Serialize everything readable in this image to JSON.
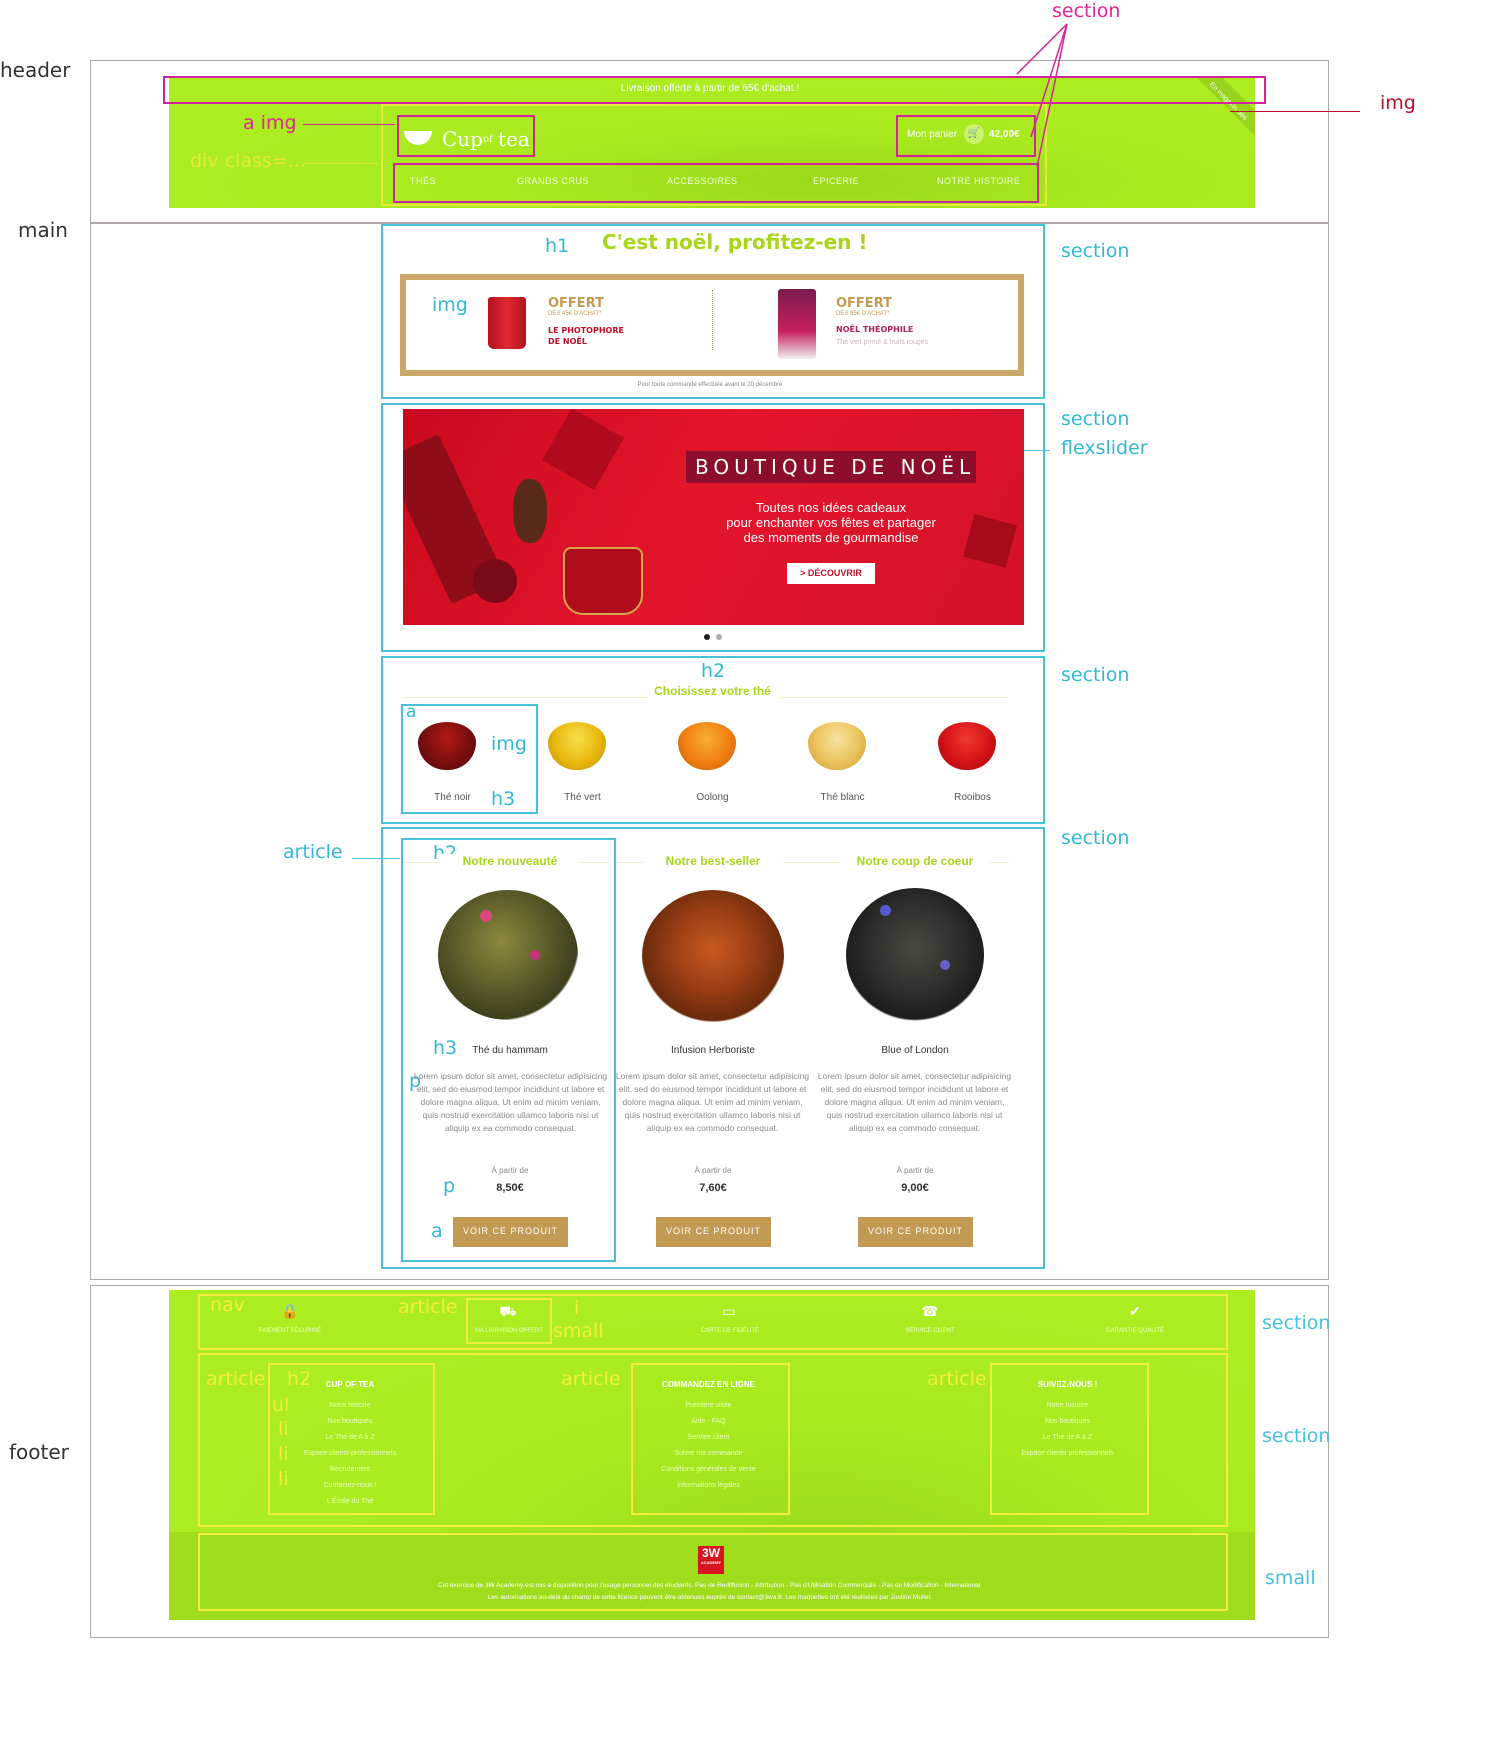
{
  "regions": {
    "header": "header",
    "main": "main",
    "footer": "footer"
  },
  "annotations": {
    "section_top": "section",
    "img_corner": "img",
    "a_img": "a img",
    "div_class": "div class=...",
    "h1": "h1",
    "img_offer": "img",
    "section_h1": "section",
    "section_slider": "section",
    "flexslider": "flexslider",
    "h2_choose": "h2",
    "a_cup": "a",
    "img_cup": "img",
    "h3_cup": "h3",
    "section_choose": "section",
    "article": "article",
    "h2_prod": "h2",
    "section_prod": "section",
    "h3_prod": "h3",
    "p_desc": "p",
    "p_price": "p",
    "a_btn": "a",
    "nav": "nav",
    "article_nav": "article",
    "i": "i",
    "small_nav": "small",
    "section_nav": "section",
    "article_1": "article",
    "h2_footer": "h2",
    "ul": "ul",
    "li_1": "li",
    "li_2": "li",
    "li_3": "li",
    "li_4": "li",
    "article_2": "article",
    "article_3": "article",
    "section_footer": "section",
    "small_footer": "small"
  },
  "header": {
    "topbar": "Livraison offerte à partir de 65€ d'achat !",
    "logo": {
      "cup": "Cup",
      "of": "of",
      "tea": "tea"
    },
    "cart_label": "Mon panier",
    "cart_total": "42,00€",
    "ribbon": "En magasin dès",
    "nav": [
      "THÉS",
      "GRANDS CRUS",
      "ACCESSOIRES",
      "EPICERIE",
      "NOTRE HISTOIRE"
    ]
  },
  "promo": {
    "title": "C'est noël, profitez-en !",
    "offer1": {
      "title": "OFFERT",
      "sub": "DÈS 45€ D'ACHAT*",
      "name1": "LE PHOTOPHORE",
      "name2": "DE NOËL"
    },
    "offer2": {
      "title": "OFFERT",
      "sub": "DÈS 85€ D'ACHAT*",
      "name": "NOËL THÉOPHILE",
      "desc": "Thé vert primé & fruits rouges"
    },
    "footnote": "Pour toute commande effectuée avant le 20 décembre"
  },
  "slider": {
    "title": "BOUTIQUE DE NOËL",
    "line1": "Toutes nos idées cadeaux",
    "line2": "pour enchanter vos fêtes et partager",
    "line3": "des moments de gourmandise",
    "button": "> DÉCOUVRIR"
  },
  "choose": {
    "title": "Choisissez votre thé",
    "teas": [
      {
        "label": "Thé noir",
        "color": "#7a0e10"
      },
      {
        "label": "Thé vert",
        "color": "#e8b80e"
      },
      {
        "label": "Oolong",
        "color": "#f07e12"
      },
      {
        "label": "Thé blanc",
        "color": "#ebc25a"
      },
      {
        "label": "Rooibos",
        "color": "#d31216"
      }
    ]
  },
  "products": [
    {
      "heading": "Notre nouveauté",
      "name": "Thé du hammam",
      "desc": "Lorem ipsum dolor sit amet, consectetur adipisicing elit, sed do eiusmod tempor incididunt ut labore et dolore magna aliqua. Ut enim ad minim veniam, quis nostrud exercitation ullamco laboris nisi ut aliquip ex ea commodo consequat.",
      "from": "À partir de",
      "price": "8,50€",
      "button": "VOIR CE PRODUIT"
    },
    {
      "heading": "Notre best-seller",
      "name": "Infusion Herboriste",
      "desc": "Lorem ipsum dolor sit amet, consectetur adipisicing elit, sed do eiusmod tempor incididunt ut labore et dolore magna aliqua. Ut enim ad minim veniam, quis nostrud exercitation ullamco laboris nisi ut aliquip ex ea commodo consequat.",
      "from": "À partir de",
      "price": "7,60€",
      "button": "VOIR CE PRODUIT"
    },
    {
      "heading": "Notre coup de coeur",
      "name": "Blue of London",
      "desc": "Lorem ipsum dolor sit amet, consectetur adipisicing elit, sed do eiusmod tempor incididunt ut labore et dolore magna aliqua. Ut enim ad minim veniam, quis nostrud exercitation ullamco laboris nisi ut aliquip ex ea commodo consequat.",
      "from": "À partir de",
      "price": "9,00€",
      "button": "VOIR CE PRODUIT"
    }
  ],
  "footer": {
    "features": [
      "PAIEMENT SÉCURISÉ",
      "MA LIVRAISON OFFERT",
      "CARTE DE FIDÉLITÉ",
      "SERVICE CLIENT",
      "GARANTIE QUALITÉ"
    ],
    "col1": {
      "title": "CUP OF TEA",
      "items": [
        "Notre histoire",
        "Nos boutiques",
        "Le Thé de A à Z",
        "Espace clients professionnels",
        "Recrutement",
        "Contactez-nous !",
        "L'École du Thé"
      ]
    },
    "col2": {
      "title": "COMMANDEZ EN LIGNE",
      "items": [
        "Première visite",
        "Aide - FAQ",
        "Service client",
        "Suivre ma commande",
        "Conditions générales de vente",
        "Informations légales"
      ]
    },
    "col3": {
      "title": "SUIVEZ-NOUS !",
      "items": [
        "Notre histoire",
        "Nos boutiques",
        "Le Thé de A à Z",
        "Espace clients professionnels"
      ]
    },
    "badge": "3W",
    "badge_sub": "ACADEMY",
    "legal1": "Cet exercice de 3W Academy est mis à disposition pour l'usage personnel des étudiants. Pas de Rediffusion - Attribution - Pas d'Utilisation Commerciale - Pas de Modification - International.",
    "legal2": "Les autorisations au-delà du champ de cette licence peuvent être obtenues auprès de contact@3wa.fr. Les maquettes ont été réalisées par Justine Muller."
  },
  "colors": {
    "magenta": "#d4239a",
    "cyan": "#48c2dc",
    "yellow": "#f2ee3c",
    "green": "#a9ec1d",
    "gold": "#c39a53",
    "red": "#c8102e"
  }
}
